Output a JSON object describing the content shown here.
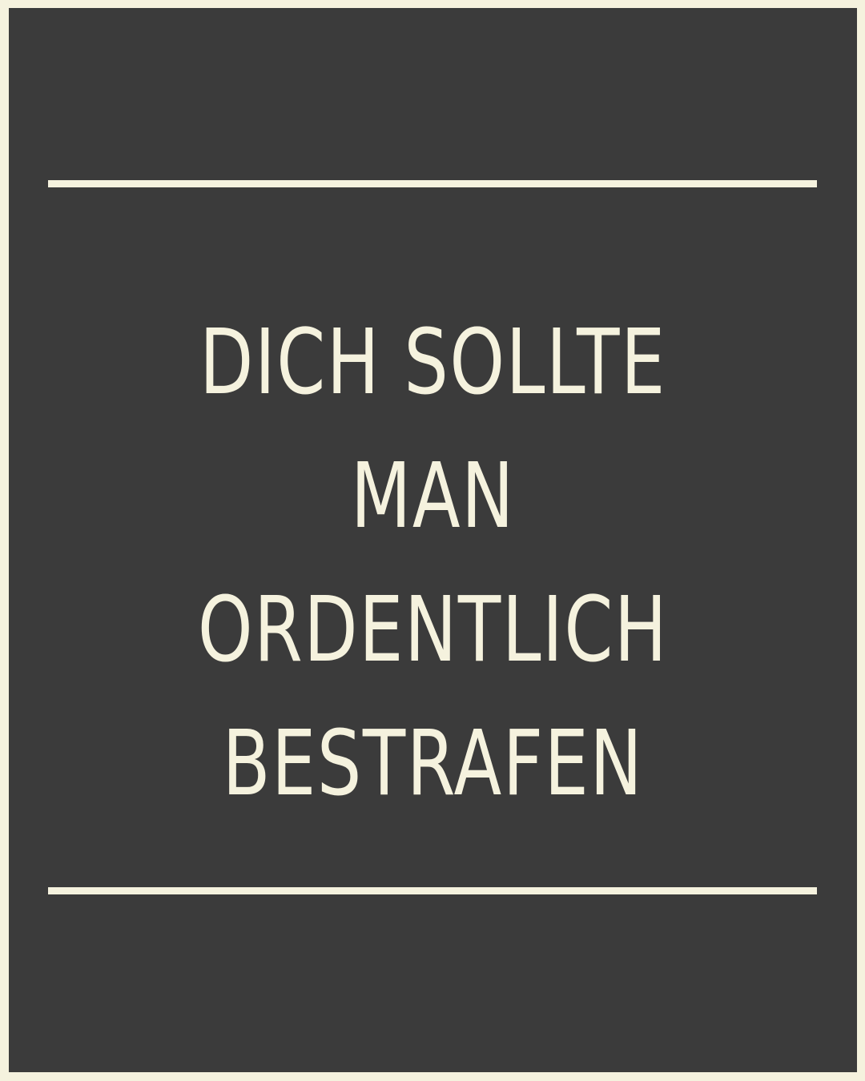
{
  "quote": {
    "lines": [
      "DICH SOLLTE",
      "MAN",
      "ORDENTLICH",
      "BESTRAFEN"
    ]
  },
  "colors": {
    "background": "#3b3b3b",
    "accent": "#f5f2de"
  }
}
